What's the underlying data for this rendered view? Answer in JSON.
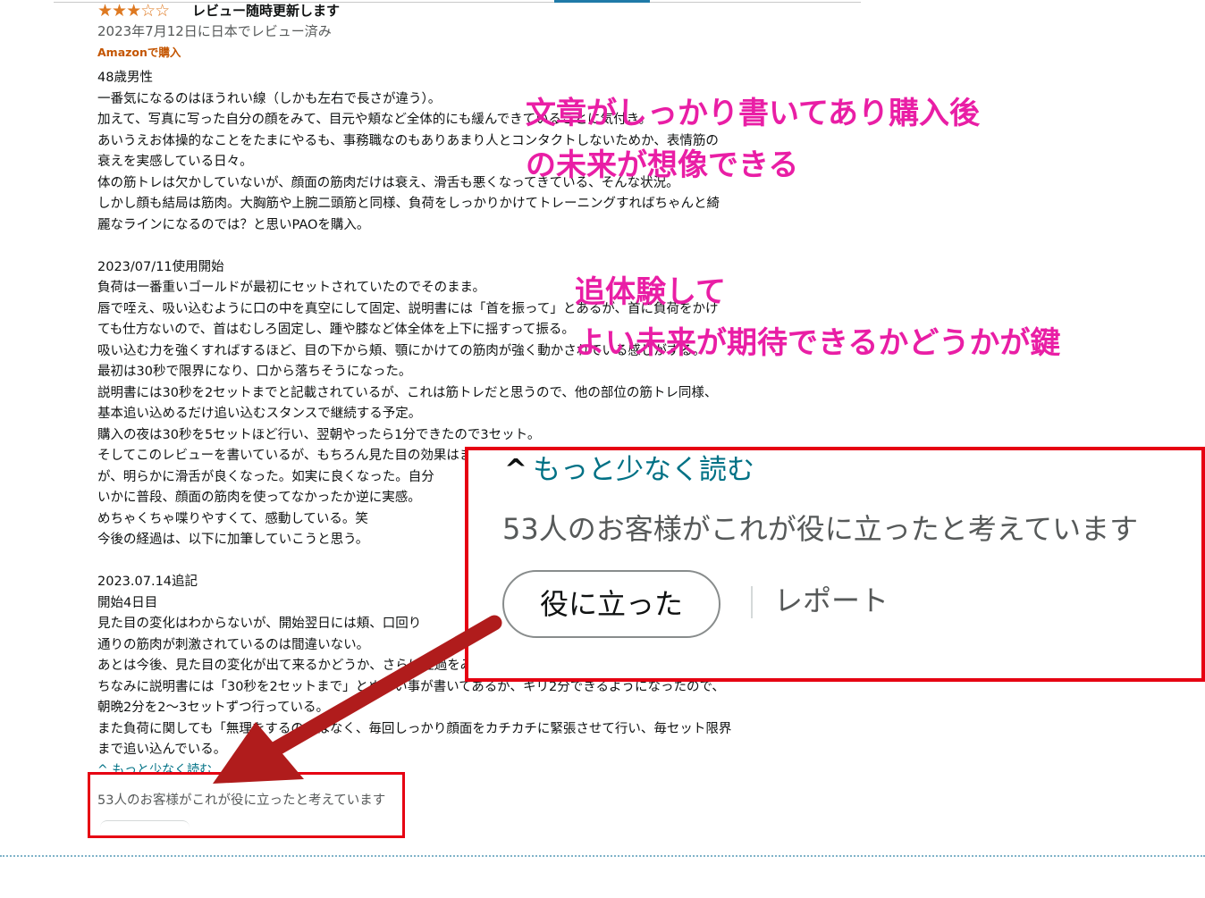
{
  "review": {
    "stars": {
      "rating": 3,
      "max": 5,
      "full": "★★★",
      "empty": "☆☆"
    },
    "title": "レビュー随時更新します",
    "date": "2023年7月12日に日本でレビュー済み",
    "verified": "Amazonで購入",
    "body_lines": [
      "48歳男性",
      "一番気になるのはほうれい線（しかも左右で長さが違う）。",
      "加えて、写真に写った自分の顔をみて、目元や頬など全体的にも緩んできていることに気付き。",
      "あいうえお体操的なことをたまにやるも、事務職なのもありあまり人とコンタクトしないためか、表情筋の",
      "衰えを実感している日々。",
      "体の筋トレは欠かしていないが、顔面の筋肉だけは衰え、滑舌も悪くなってきている、そんな状況。",
      "しかし顔も結局は筋肉。大胸筋や上腕二頭筋と同様、負荷をしっかりかけてトレーニングすればちゃんと綺",
      "麗なラインになるのでは？と思いPAOを購入。",
      "",
      "2023/07/11使用開始",
      "負荷は一番重いゴールドが最初にセットされていたのでそのまま。",
      "唇で咥え、吸い込むように口の中を真空にして固定、説明書には「首を振って」とあるが、首に負荷をかけ",
      "ても仕方ないので、首はむしろ固定し、踵や膝など体全体を上下に揺すって振る。",
      "吸い込む力を強くすればするほど、目の下から頬、顎にかけての筋肉が強く動かされている感じがする。",
      "最初は30秒で限界になり、口から落ちそうになった。",
      "説明書には30秒を2セットまでと記載されているが、これは筋トレだと思うので、他の部位の筋トレ同様、",
      "基本追い込めるだけ追い込むスタンスで継続する予定。",
      "購入の夜は30秒を5セットほど行い、翌朝やったら1分できたので3セット。",
      "そしてこのレビューを書いているが、もちろん見た目の効果はまだない",
      "が、明らかに滑舌が良くなった。如実に良くなった。自分",
      "いかに普段、顔面の筋肉を使ってなかったか逆に実感。",
      "めちゃくちゃ喋りやすくて、感動している。笑",
      "今後の経過は、以下に加筆していこうと思う。",
      "",
      "2023.07.14追記",
      "開始4日目",
      "見た目の変化はわからないが、開始翌日には頬、口回り",
      "通りの筋肉が刺激されているのは間違いない。",
      "あとは今後、見た目の変化が出て来るかどうか、さらに経過をみていこうと思う。",
      "ちなみに説明書には「30秒を2セットまで」とぬるい事が書いてあるが、キリ2分できるようになったので、",
      "朝晩2分を2〜3セットずつ行っている。",
      "また負荷に関しても「無理をするのではなく、毎回しっかり顔面をカチカチに緊張させて行い、毎セット限界",
      "まで追い込んでいる。"
    ],
    "see_less": "もっと少なく読む",
    "helpful_text": "53人のお客様がこれが役に立ったと考えています"
  },
  "zoom": {
    "see_less": "もっと少なく読む",
    "chevron": "^",
    "helpful_text": "53人のお客様がこれが役に立ったと考えています",
    "helpful_button": "役に立った",
    "report": "レポート"
  },
  "annotations": {
    "note1_line1": "文章がしっかり書いてあり購入後",
    "note1_line2": "の未来が想像できる",
    "note2_line1": "追体験して",
    "note2_line2": "よい未来が期待できるかどうかが鍵"
  },
  "colors": {
    "annotation_pink": "#e91ea5",
    "highlight_red": "#e60012",
    "arrow_red": "#b01c1c",
    "star_orange": "#de7921",
    "link_teal": "#007185",
    "verified_orange": "#c45500"
  },
  "icons": {
    "stars": "star-rating-icon",
    "chevron": "chevron-up-icon",
    "arrow": "arrow-annotation-icon"
  }
}
